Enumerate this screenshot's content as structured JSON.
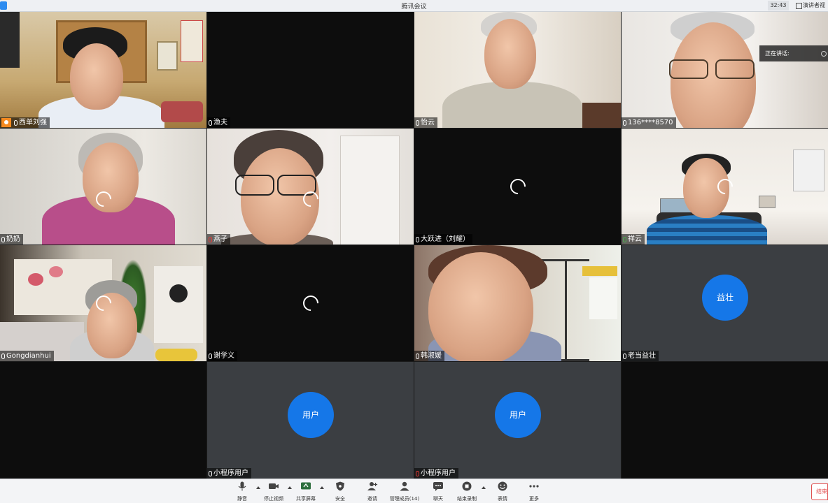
{
  "window": {
    "title": "腾讯会议",
    "time": "32:43",
    "speaker_mode": "演讲者视"
  },
  "speaking_tip": "正在讲话:",
  "participants": [
    {
      "name": "西单刘强"
    },
    {
      "name": "渔夫"
    },
    {
      "name": "怡云"
    },
    {
      "name": "136****8570"
    },
    {
      "name": "奶奶"
    },
    {
      "name": "燕子"
    },
    {
      "name": "大跃进（刘耀）"
    },
    {
      "name": "祥云"
    },
    {
      "name": "Gongdianhui"
    },
    {
      "name": "谢学义"
    },
    {
      "name": "韩淑媛"
    },
    {
      "name": "老当益壮",
      "avatar": "益壮"
    },
    {
      "name": "小程序用户",
      "avatar": "用户"
    },
    {
      "name": "小程序用户",
      "avatar": "用户"
    }
  ],
  "toolbar": {
    "mute": "静音",
    "stop_video": "停止视频",
    "share_screen": "共享屏幕",
    "security": "安全",
    "invite": "邀请",
    "manage_members": "管理成员(14)",
    "chat": "聊天",
    "end_recording": "结束录制",
    "reactions": "表情",
    "more": "更多",
    "end": "结束"
  },
  "colors": {
    "avatar_blue": "#1577e8",
    "host_badge": "#f5891f",
    "end_red": "#e05252"
  }
}
